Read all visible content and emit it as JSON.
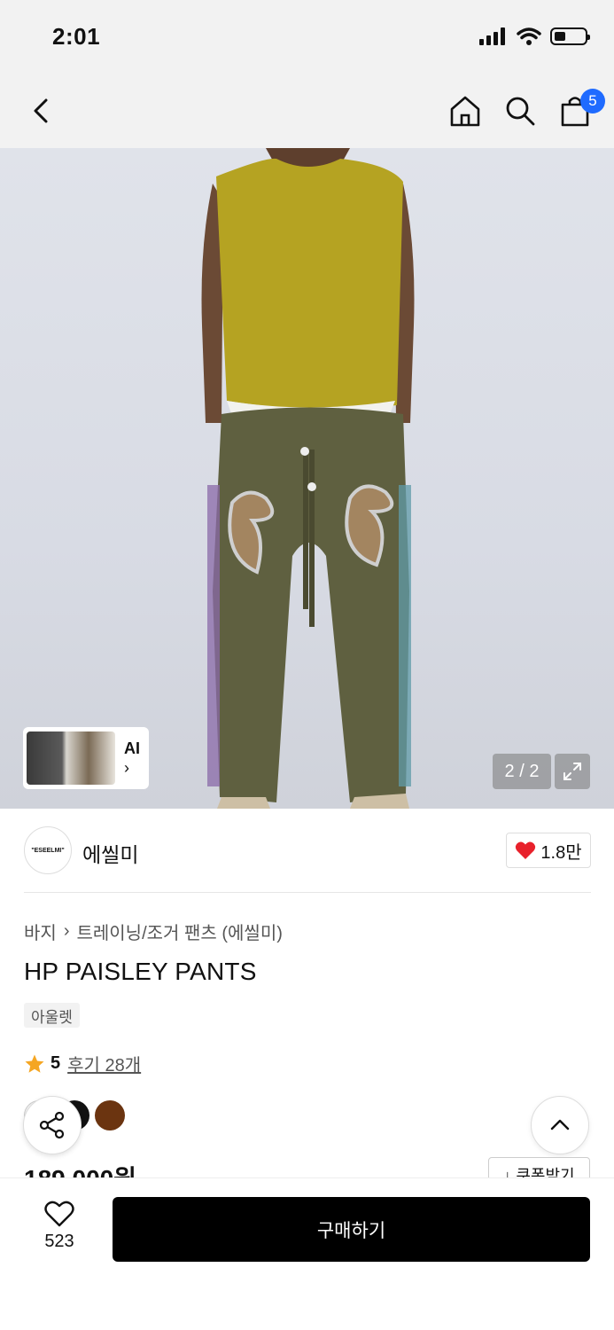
{
  "status_bar": {
    "time": "2:01"
  },
  "nav": {
    "cart_count": "5"
  },
  "hero": {
    "thumb_label": "AI",
    "thumb_chevron": "›",
    "page_indicator": "2 / 2"
  },
  "brand": {
    "logo_text": "\"ESEELMI\"",
    "name": "에씰미",
    "likes": "1.8만"
  },
  "product": {
    "breadcrumb": [
      "바지",
      "트레이닝/조거 팬츠 (에씰미)"
    ],
    "breadcrumb_sep": "›",
    "title": "HP PAISLEY PANTS",
    "tag": "아울렛",
    "rating_score": "5",
    "review_link": "후기 28개",
    "colors": [
      "#f4f4f4",
      "#111111",
      "#6b3410"
    ],
    "price": "189,000원",
    "coupon_label": "↓ 쿠폰받기"
  },
  "bottom": {
    "wish_count": "523",
    "buy_label": "구매하기"
  },
  "colors": {
    "accent_badge": "#1f6bff",
    "heart": "#e8212b",
    "star": "#f5a623"
  }
}
